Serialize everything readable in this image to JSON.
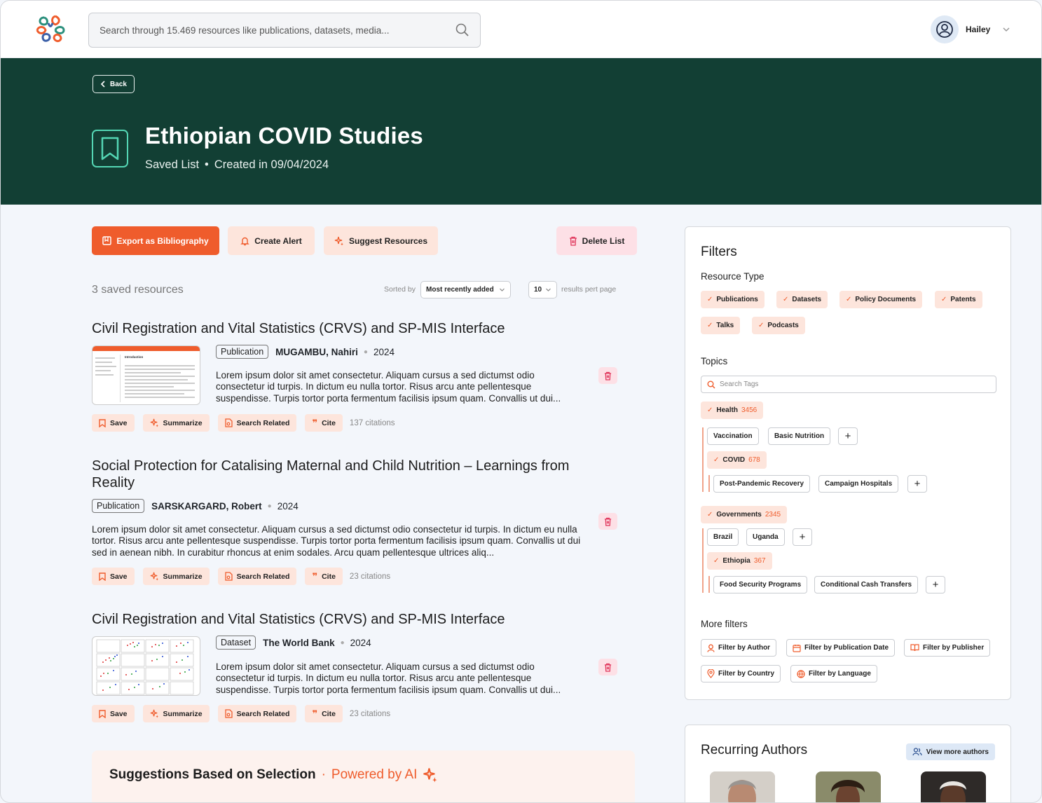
{
  "header": {
    "search_placeholder": "Search through 15.469 resources like publications, datasets, media...",
    "user_name": "Hailey"
  },
  "hero": {
    "back_label": "Back",
    "title": "Ethiopian COVID Studies",
    "subtitle_type": "Saved List",
    "subtitle_sep": "•",
    "subtitle_created": "Created in 09/04/2024"
  },
  "actions": {
    "export": "Export as Bibliography",
    "alert": "Create Alert",
    "suggest": "Suggest Resources",
    "delete": "Delete List"
  },
  "list": {
    "count": "3 saved resources",
    "sorted_by_label": "Sorted by",
    "sort_value": "Most recently added",
    "per_page_value": "10",
    "per_page_label": "results pert page"
  },
  "item_actions": {
    "save": "Save",
    "summarize": "Summarize",
    "search_related": "Search Related",
    "cite": "Cite"
  },
  "results": [
    {
      "title": "Civil Registration and Vital Statistics (CRVS) and SP-MIS Interface",
      "type": "Publication",
      "author": "MUGAMBU, Nahiri",
      "year": "2024",
      "description": "Lorem ipsum dolor sit amet consectetur. Aliquam cursus a sed dictumst odio consectetur id turpis. In dictum eu nulla tortor. Risus arcu ante pellentesque suspendisse. Turpis tortor porta fermentum facilisis ipsum quam. Convallis ut dui...",
      "citations": "137 citations",
      "thumb_heading": "Introduction"
    },
    {
      "title": "Social Protection for Catalising Maternal and Child Nutrition – Learnings from Reality",
      "type": "Publication",
      "author": "SARSKARGARD, Robert",
      "year": "2024",
      "description": "Lorem ipsum dolor sit amet consectetur. Aliquam cursus a sed dictumst odio consectetur id turpis. In dictum eu nulla tortor. Risus arcu ante pellentesque suspendisse. Turpis tortor porta fermentum facilisis ipsum quam. Convallis ut dui sed in aenean nibh. In curabitur rhoncus at enim sodales. Arcu quam pellentesque ultrices aliq...",
      "citations": "23 citations"
    },
    {
      "title": "Civil Registration and Vital Statistics (CRVS) and SP-MIS Interface",
      "type": "Dataset",
      "author": "The World Bank",
      "year": "2024",
      "description": "Lorem ipsum dolor sit amet consectetur. Aliquam cursus a sed dictumst odio consectetur id turpis. In dictum eu nulla tortor. Risus arcu ante pellentesque suspendisse. Turpis tortor porta fermentum facilisis ipsum quam. Convallis ut dui...",
      "citations": "23 citations"
    }
  ],
  "suggestions": {
    "title": "Suggestions Based on Selection",
    "sep": "·",
    "powered": "Powered by AI"
  },
  "filters": {
    "title": "Filters",
    "resource_type_label": "Resource Type",
    "resource_types": [
      "Publications",
      "Datasets",
      "Policy Documents",
      "Patents",
      "Talks",
      "Podcasts"
    ],
    "topics_label": "Topics",
    "search_tags_placeholder": "Search Tags",
    "health": {
      "label": "Health",
      "count": "3456"
    },
    "health_children": [
      "Vaccination",
      "Basic Nutrition"
    ],
    "covid": {
      "label": "COVID",
      "count": "678"
    },
    "covid_children": [
      "Post-Pandemic Recovery",
      "Campaign Hospitals"
    ],
    "governments": {
      "label": "Governments",
      "count": "2345"
    },
    "gov_children": [
      "Brazil",
      "Uganda"
    ],
    "ethiopia": {
      "label": "Ethiopia",
      "count": "367"
    },
    "ethiopia_children": [
      "Food Security Programs",
      "Conditional Cash Transfers"
    ],
    "plus": "+",
    "more_label": "More filters",
    "more": [
      "Filter by Author",
      "Filter by Publication Date",
      "Filter by Publisher",
      "Filter by Country",
      "Filter by Language"
    ]
  },
  "recurring": {
    "title": "Recurring Authors",
    "view_more": "View more authors"
  },
  "colors": {
    "accent": "#ef5c2c",
    "hero_bg": "#123f34",
    "teal": "#54d6b4"
  }
}
